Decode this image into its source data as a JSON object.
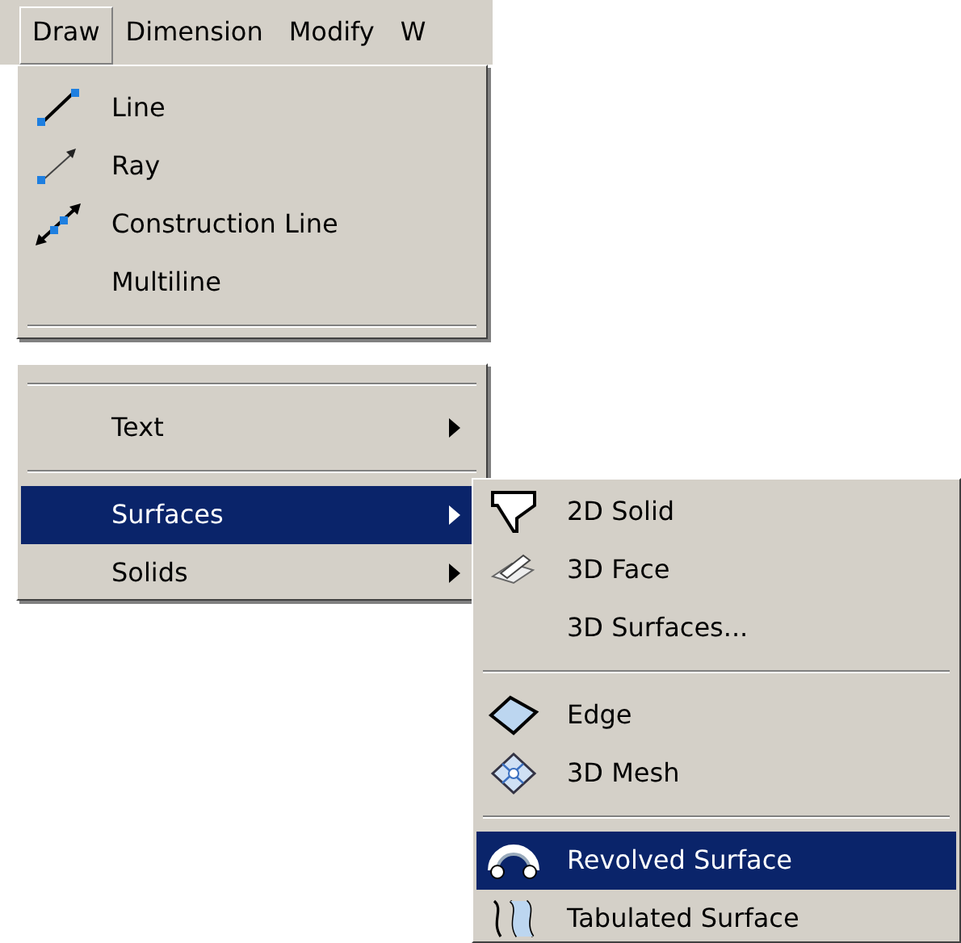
{
  "menubar": [
    {
      "label": "Draw",
      "selected": true
    },
    {
      "label": "Dimension",
      "selected": false
    },
    {
      "label": "Modify",
      "selected": false
    },
    {
      "label": "W",
      "selected": false
    }
  ],
  "draw_menu_top": [
    {
      "kind": "command",
      "label": "Line",
      "submenu": false,
      "selected": false
    },
    {
      "kind": "command",
      "label": "Ray",
      "submenu": false,
      "selected": false
    },
    {
      "kind": "command",
      "label": "Construction Line",
      "submenu": false,
      "selected": false
    },
    {
      "kind": "command",
      "label": "Multiline",
      "submenu": false,
      "selected": false
    },
    {
      "kind": "separator"
    }
  ],
  "draw_menu_bottom": [
    {
      "kind": "separator"
    },
    {
      "kind": "command",
      "label": "Text",
      "submenu": true,
      "selected": false
    },
    {
      "kind": "separator"
    },
    {
      "kind": "command",
      "label": "Surfaces",
      "submenu": true,
      "selected": true
    },
    {
      "kind": "command",
      "label": "Solids",
      "submenu": true,
      "selected": false
    }
  ],
  "surfaces_menu": [
    {
      "kind": "command",
      "label": "2D Solid",
      "submenu": false,
      "selected": false
    },
    {
      "kind": "command",
      "label": "3D Face",
      "submenu": false,
      "selected": false
    },
    {
      "kind": "command",
      "label": "3D Surfaces...",
      "submenu": false,
      "selected": false
    },
    {
      "kind": "separator"
    },
    {
      "kind": "command",
      "label": "Edge",
      "submenu": false,
      "selected": false
    },
    {
      "kind": "command",
      "label": "3D Mesh",
      "submenu": false,
      "selected": false
    },
    {
      "kind": "separator"
    },
    {
      "kind": "command",
      "label": "Revolved Surface",
      "submenu": false,
      "selected": true
    },
    {
      "kind": "command",
      "label": "Tabulated Surface",
      "submenu": false,
      "selected": false
    }
  ]
}
